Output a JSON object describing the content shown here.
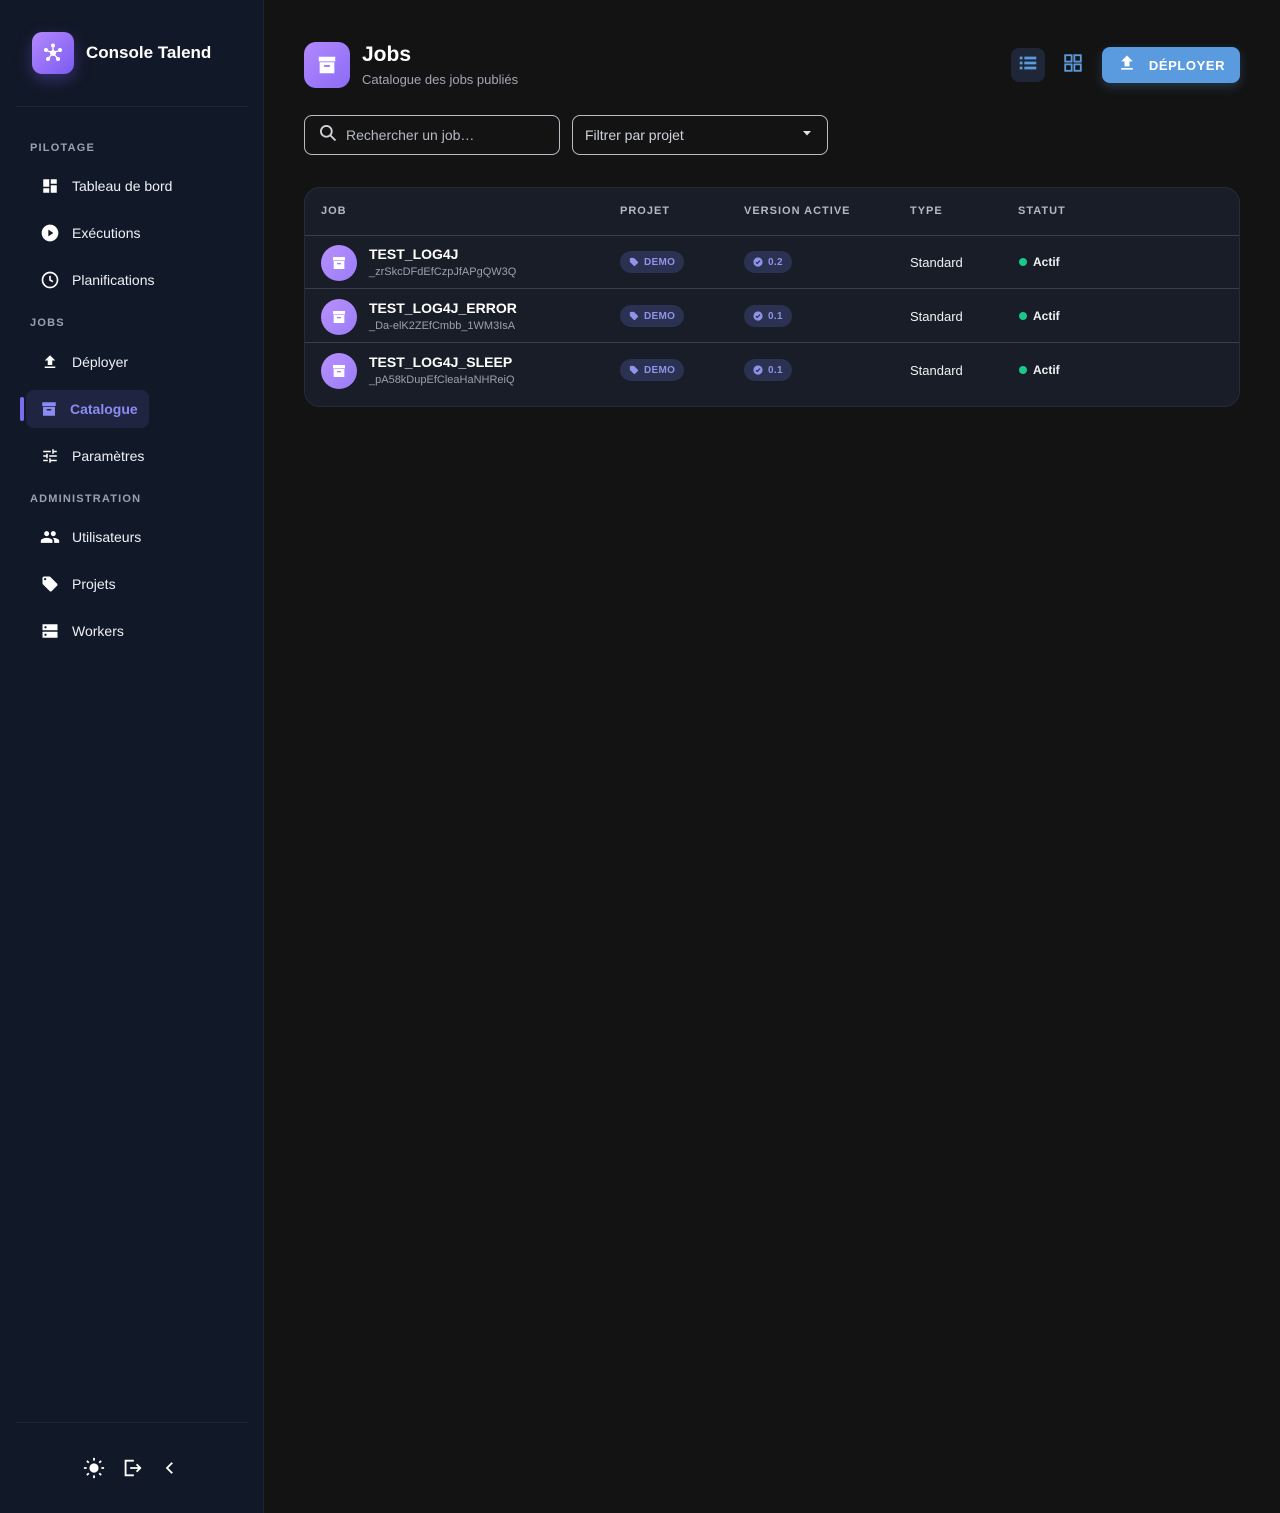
{
  "app": {
    "name": "Console Talend"
  },
  "sidebar": {
    "sections": [
      {
        "label": "PILOTAGE"
      },
      {
        "label": "JOBS"
      },
      {
        "label": "ADMINISTRATION"
      }
    ],
    "items": [
      {
        "label": "Tableau de bord",
        "icon": "dashboard-icon"
      },
      {
        "label": "Exécutions",
        "icon": "play-circle-icon"
      },
      {
        "label": "Planifications",
        "icon": "clock-icon"
      },
      {
        "label": "Déployer",
        "icon": "upload-icon"
      },
      {
        "label": "Catalogue",
        "icon": "archive-icon",
        "active": true
      },
      {
        "label": "Paramètres",
        "icon": "tune-icon"
      },
      {
        "label": "Utilisateurs",
        "icon": "people-icon"
      },
      {
        "label": "Projets",
        "icon": "tag-icon"
      },
      {
        "label": "Workers",
        "icon": "server-icon"
      }
    ],
    "footer": [
      "theme-toggle-icon",
      "logout-icon",
      "collapse-chevron-icon"
    ]
  },
  "header": {
    "title": "Jobs",
    "subtitle": "Catalogue des jobs publiés",
    "deploy_label": "DÉPLOYER",
    "view_modes": [
      "list-view-icon",
      "grid-view-icon"
    ],
    "active_view": "list"
  },
  "filters": {
    "search_placeholder": "Rechercher un job…",
    "project_filter": "Filtrer par projet"
  },
  "table": {
    "columns": [
      "JOB",
      "PROJET",
      "VERSION ACTIVE",
      "TYPE",
      "STATUT"
    ],
    "rows": [
      {
        "name": "TEST_LOG4J",
        "id": "_zrSkcDFdEfCzpJfAPgQW3Q",
        "project": "DEMO",
        "version": "0.2",
        "type": "Standard",
        "status": "Actif"
      },
      {
        "name": "TEST_LOG4J_ERROR",
        "id": "_Da-elK2ZEfCmbb_1WM3IsA",
        "project": "DEMO",
        "version": "0.1",
        "type": "Standard",
        "status": "Actif"
      },
      {
        "name": "TEST_LOG4J_SLEEP",
        "id": "_pA58kDupEfCleaHaNHReiQ",
        "project": "DEMO",
        "version": "0.1",
        "type": "Standard",
        "status": "Actif"
      }
    ]
  },
  "colors": {
    "accent": "#8b8cf2",
    "brand_gradient_start": "#b388ff",
    "brand_gradient_end": "#7c5cf0",
    "deploy_button": "#5a9be0",
    "status_active": "#19c98a",
    "sidebar_bg": "#111827",
    "page_bg": "#131313"
  }
}
